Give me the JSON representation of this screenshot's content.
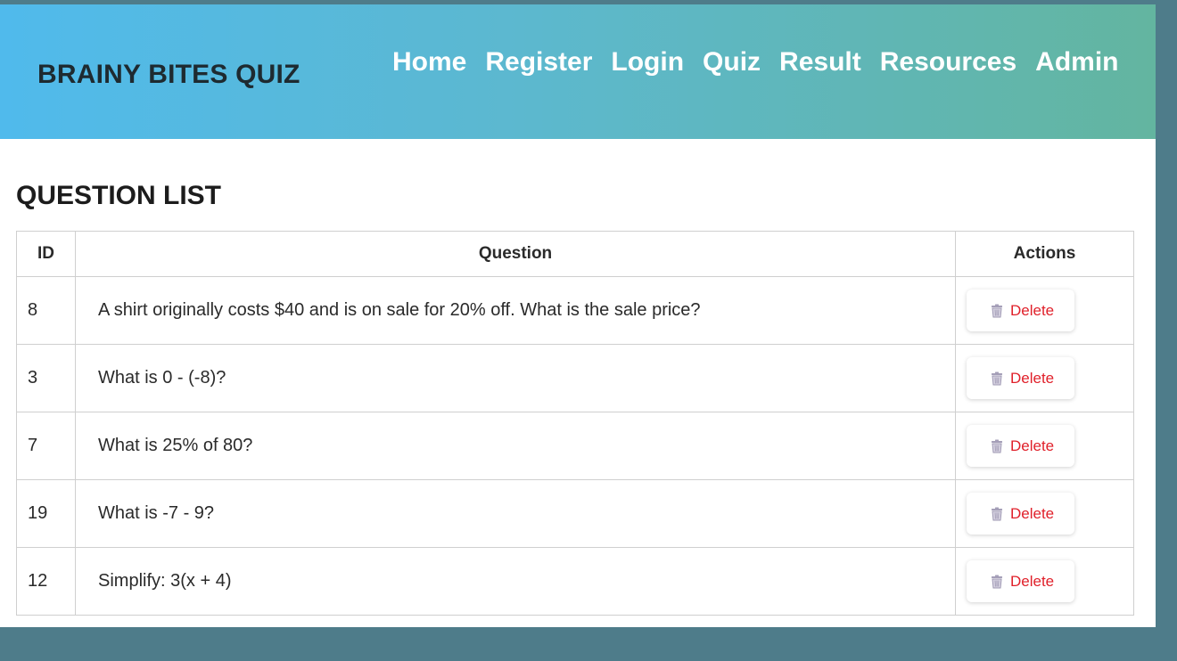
{
  "header": {
    "brand": "BRAINY BITES QUIZ",
    "nav": [
      "Home",
      "Register",
      "Login",
      "Quiz",
      "Result",
      "Resources",
      "Admin"
    ]
  },
  "main": {
    "title": "QUESTION LIST",
    "table": {
      "headers": [
        "ID",
        "Question",
        "Actions"
      ],
      "rows": [
        {
          "id": "8",
          "question": "A shirt originally costs $40 and is on sale for 20% off. What is the sale price?",
          "action": "Delete"
        },
        {
          "id": "3",
          "question": "What is 0 - (-8)?",
          "action": "Delete"
        },
        {
          "id": "7",
          "question": "What is 25% of 80?",
          "action": "Delete"
        },
        {
          "id": "19",
          "question": "What is -7 - 9?",
          "action": "Delete"
        },
        {
          "id": "12",
          "question": "Simplify: 3(x + 4)",
          "action": "Delete"
        }
      ]
    }
  },
  "colors": {
    "header_gradient_start": "#50baec",
    "header_gradient_end": "#63b5a0",
    "delete_text": "#e0202a",
    "backdrop": "#4e7c8a"
  },
  "icons": {
    "delete": "trash-icon"
  }
}
